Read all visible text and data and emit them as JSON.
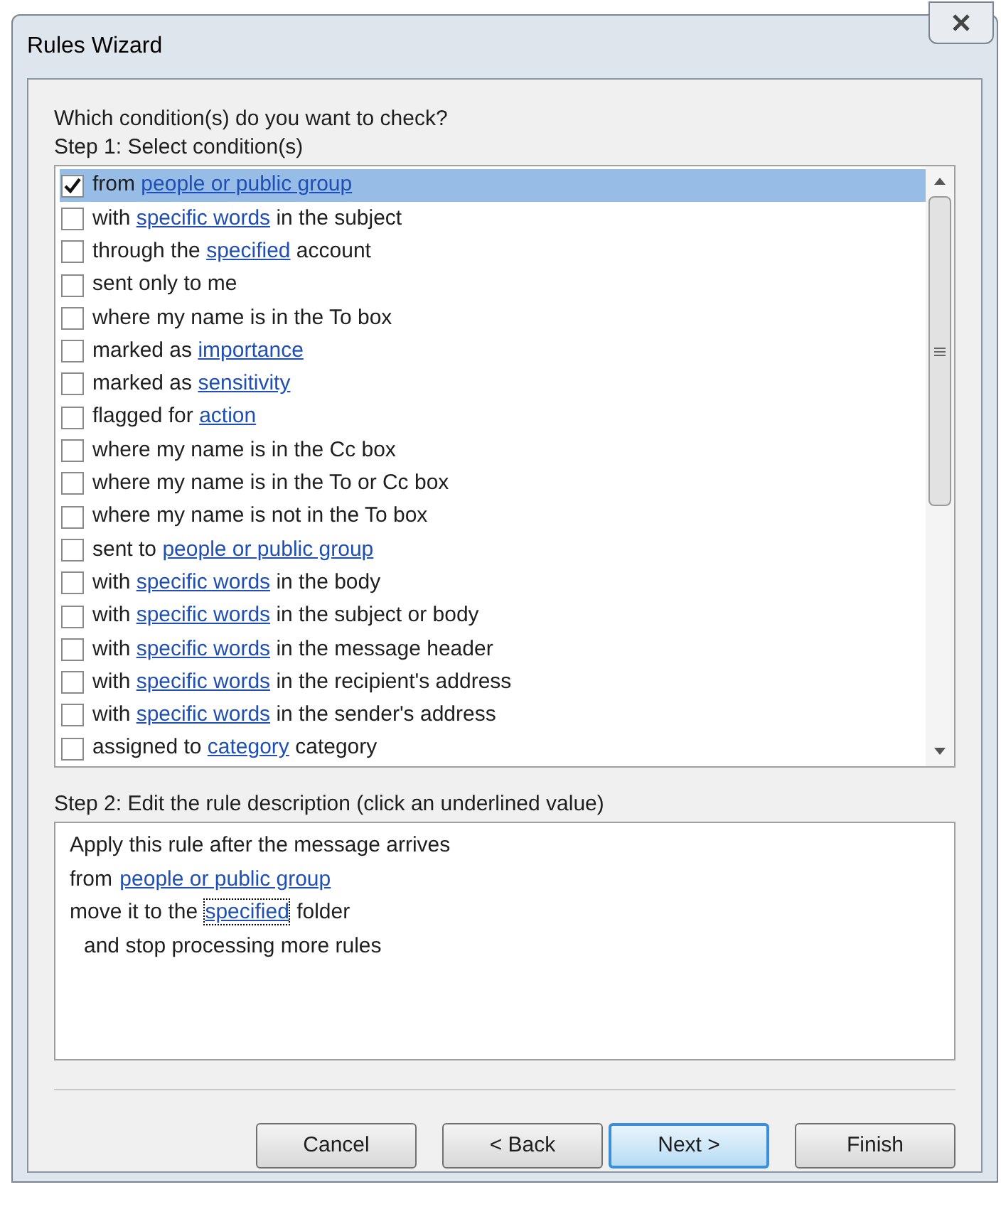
{
  "window": {
    "title": "Rules Wizard"
  },
  "question": "Which condition(s) do you want to check?",
  "step1_label": "Step 1: Select condition(s)",
  "conditions": [
    {
      "checked": true,
      "selected": true,
      "parts": [
        {
          "text": "from "
        },
        {
          "text": "people or public group",
          "link": true
        }
      ]
    },
    {
      "checked": false,
      "selected": false,
      "parts": [
        {
          "text": "with "
        },
        {
          "text": "specific words",
          "link": true
        },
        {
          "text": " in the subject"
        }
      ]
    },
    {
      "checked": false,
      "selected": false,
      "parts": [
        {
          "text": "through the "
        },
        {
          "text": "specified",
          "link": true
        },
        {
          "text": " account"
        }
      ]
    },
    {
      "checked": false,
      "selected": false,
      "parts": [
        {
          "text": "sent only to me"
        }
      ]
    },
    {
      "checked": false,
      "selected": false,
      "parts": [
        {
          "text": "where my name is in the To box"
        }
      ]
    },
    {
      "checked": false,
      "selected": false,
      "parts": [
        {
          "text": "marked as "
        },
        {
          "text": "importance",
          "link": true
        }
      ]
    },
    {
      "checked": false,
      "selected": false,
      "parts": [
        {
          "text": "marked as "
        },
        {
          "text": "sensitivity",
          "link": true
        }
      ]
    },
    {
      "checked": false,
      "selected": false,
      "parts": [
        {
          "text": "flagged for "
        },
        {
          "text": "action",
          "link": true
        }
      ]
    },
    {
      "checked": false,
      "selected": false,
      "parts": [
        {
          "text": "where my name is in the Cc box"
        }
      ]
    },
    {
      "checked": false,
      "selected": false,
      "parts": [
        {
          "text": "where my name is in the To or Cc box"
        }
      ]
    },
    {
      "checked": false,
      "selected": false,
      "parts": [
        {
          "text": "where my name is not in the To box"
        }
      ]
    },
    {
      "checked": false,
      "selected": false,
      "parts": [
        {
          "text": "sent to "
        },
        {
          "text": "people or public group",
          "link": true
        }
      ]
    },
    {
      "checked": false,
      "selected": false,
      "parts": [
        {
          "text": "with "
        },
        {
          "text": "specific words",
          "link": true
        },
        {
          "text": " in the body"
        }
      ]
    },
    {
      "checked": false,
      "selected": false,
      "parts": [
        {
          "text": "with "
        },
        {
          "text": "specific words",
          "link": true
        },
        {
          "text": " in the subject or body"
        }
      ]
    },
    {
      "checked": false,
      "selected": false,
      "parts": [
        {
          "text": "with "
        },
        {
          "text": "specific words",
          "link": true
        },
        {
          "text": " in the message header"
        }
      ]
    },
    {
      "checked": false,
      "selected": false,
      "parts": [
        {
          "text": "with "
        },
        {
          "text": "specific words",
          "link": true
        },
        {
          "text": " in the recipient's address"
        }
      ]
    },
    {
      "checked": false,
      "selected": false,
      "parts": [
        {
          "text": "with "
        },
        {
          "text": "specific words",
          "link": true
        },
        {
          "text": " in the sender's address"
        }
      ]
    },
    {
      "checked": false,
      "selected": false,
      "parts": [
        {
          "text": "assigned to "
        },
        {
          "text": "category",
          "link": true
        },
        {
          "text": " category"
        }
      ]
    }
  ],
  "step2_label": "Step 2: Edit the rule description (click an underlined value)",
  "description": [
    {
      "indented": false,
      "parts": [
        {
          "text": "Apply this rule after the message arrives"
        }
      ]
    },
    {
      "indented": false,
      "parts": [
        {
          "text": "from "
        },
        {
          "text": "people or public group",
          "link": true,
          "focused": false
        }
      ]
    },
    {
      "indented": false,
      "parts": [
        {
          "text": "move it to the "
        },
        {
          "text": "specified",
          "link": true,
          "focused": true
        },
        {
          "text": " folder"
        }
      ]
    },
    {
      "indented": true,
      "parts": [
        {
          "text": "and stop processing more rules"
        }
      ]
    }
  ],
  "buttons": [
    {
      "label": "Cancel",
      "default": false
    },
    {
      "label": "< Back",
      "default": false
    },
    {
      "label": "Next >",
      "default": true
    },
    {
      "label": "Finish",
      "default": false
    }
  ]
}
